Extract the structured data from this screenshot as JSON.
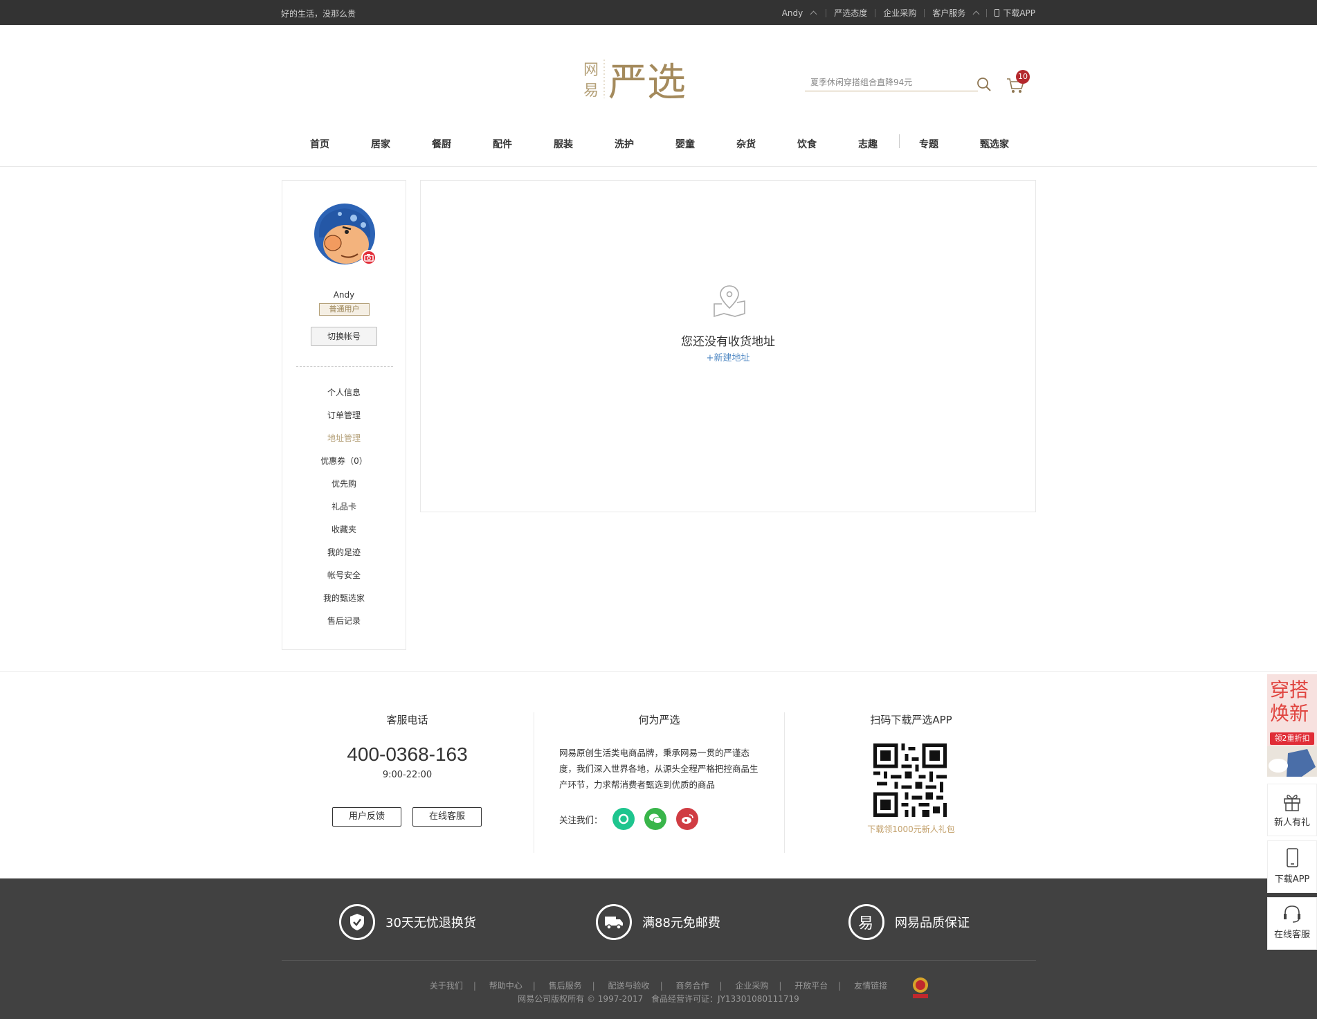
{
  "topbar": {
    "slogan": "好的生活，没那么贵",
    "user": "Andy",
    "links": [
      "严选态度",
      "企业采购",
      "客户服务"
    ],
    "download": "下载APP"
  },
  "header": {
    "logo_small": "网易",
    "logo_big": "严选",
    "search_placeholder": "夏季休闲穿搭组合直降94元",
    "cart_count": "10",
    "nav": [
      "首页",
      "居家",
      "餐厨",
      "配件",
      "服装",
      "洗护",
      "婴童",
      "杂货",
      "饮食",
      "志趣",
      "专题",
      "甄选家"
    ]
  },
  "sidebar": {
    "username": "Andy",
    "level": "普通用户",
    "switch": "切换帐号",
    "menu": [
      "个人信息",
      "订单管理",
      "地址管理",
      "优惠券（0）",
      "优先购",
      "礼品卡",
      "收藏夹",
      "我的足迹",
      "帐号安全",
      "我的甄选家",
      "售后记录"
    ],
    "active_index": 2
  },
  "main": {
    "empty_text": "您还没有收货地址",
    "new_address": "+新建地址"
  },
  "footer": {
    "service_title": "客服电话",
    "service_phone": "400-0368-163",
    "service_hours": "9:00-22:00",
    "feedback": "用户反馈",
    "online": "在线客服",
    "about_title": "何为严选",
    "about_text": "网易原创生活类电商品牌，秉承网易一贯的严谨态度，我们深入世界各地，从源头全程严格把控商品生产环节，力求帮消费者甄选到优质的商品",
    "follow": "关注我们：",
    "app_title": "扫码下载严选APP",
    "app_gift": "下载领1000元新人礼包",
    "guarantees": [
      "30天无忧退换货",
      "满88元免邮费",
      "网易品质保证"
    ],
    "links": [
      "关于我们",
      "帮助中心",
      "售后服务",
      "配送与验收",
      "商务合作",
      "企业采购",
      "开放平台",
      "友情链接"
    ],
    "copyright": "网易公司版权所有 © 1997-2017",
    "license": "食品经营许可证：JY13301080111719"
  },
  "floats": {
    "promo_title": "穿搭焕新",
    "promo_tag": "领2重折扣",
    "gift": "新人有礼",
    "app": "下载APP",
    "service": "在线客服"
  },
  "colors": {
    "brand_gold": "#b4a078",
    "topbar_bg": "#333333",
    "footer_bg": "#414141",
    "link_blue": "#4e87c3",
    "badge_red": "#b4282d"
  }
}
